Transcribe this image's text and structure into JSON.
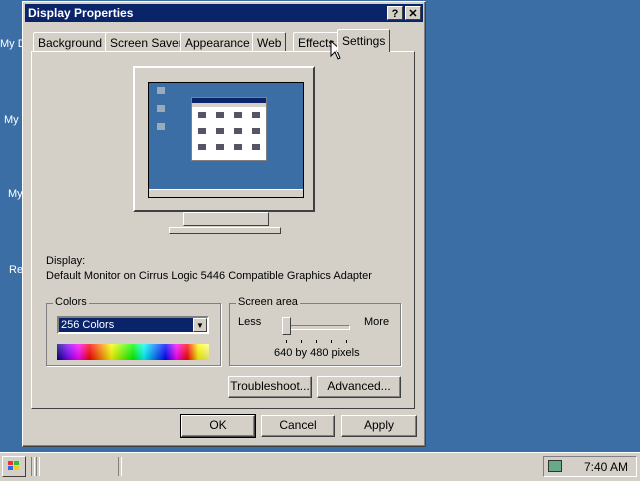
{
  "desktop": {
    "labels": [
      "My D",
      "My",
      "My",
      "Re"
    ]
  },
  "window": {
    "title": "Display Properties",
    "help_button": "?",
    "close_button": "✕"
  },
  "tabs": [
    {
      "label": "Background",
      "active": false
    },
    {
      "label": "Screen Saver",
      "active": false
    },
    {
      "label": "Appearance",
      "active": false
    },
    {
      "label": "Web",
      "active": false
    },
    {
      "label": "Effects",
      "active": false
    },
    {
      "label": "Settings",
      "active": true
    }
  ],
  "settings": {
    "display_label": "Display:",
    "display_value": "Default Monitor on Cirrus Logic 5446 Compatible Graphics Adapter",
    "colors": {
      "group_title": "Colors",
      "selected": "256 Colors"
    },
    "screen_area": {
      "group_title": "Screen area",
      "less_label": "Less",
      "more_label": "More",
      "resolution": "640 by 480 pixels",
      "slider_level": 0
    },
    "troubleshoot_label": "Troubleshoot...",
    "advanced_label": "Advanced..."
  },
  "dialog_buttons": {
    "ok": "OK",
    "cancel": "Cancel",
    "apply": "Apply"
  },
  "taskbar": {
    "clock": "7:40 AM"
  },
  "colors": {
    "desktop": "#3a6ea5",
    "titlebar": "#0a246a",
    "face": "#d4d0c8"
  }
}
